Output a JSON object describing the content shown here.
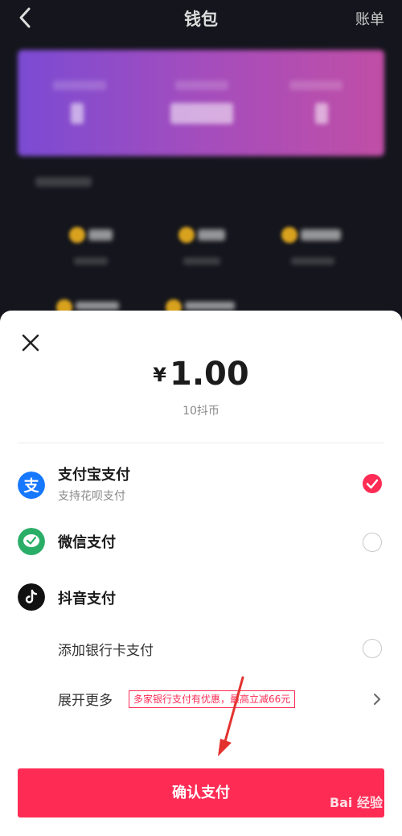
{
  "header": {
    "title": "钱包",
    "bill_label": "账单"
  },
  "payment": {
    "currency_symbol": "¥",
    "amount": "1.00",
    "coins_label": "10抖币",
    "methods": [
      {
        "name": "支付宝支付",
        "subtitle": "支持花呗支付",
        "icon": "alipay-icon",
        "selected": true
      },
      {
        "name": "微信支付",
        "icon": "wechat-pay-icon",
        "selected": false
      },
      {
        "name": "抖音支付",
        "icon": "douyin-pay-icon"
      }
    ],
    "add_bank_card": "添加银行卡支付",
    "expand_more": "展开更多",
    "promo_badge": "多家银行支付有优惠，最高立减66元",
    "confirm_label": "确认支付"
  },
  "watermark": "Bai 经验",
  "colors": {
    "accent": "#fe2c55",
    "alipay": "#1677ff",
    "wechat": "#2aae67",
    "sheet_bg": "#ffffff",
    "page_bg": "#15161d"
  }
}
